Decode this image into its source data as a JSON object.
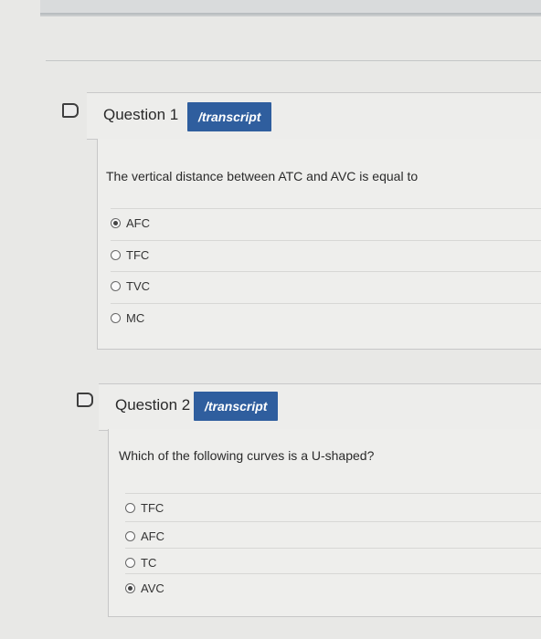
{
  "questions": [
    {
      "title": "Question 1",
      "transcript_label": "/transcript",
      "text": "The vertical distance between ATC and AVC is equal to",
      "options": [
        {
          "label": "AFC",
          "selected": true
        },
        {
          "label": "TFC",
          "selected": false
        },
        {
          "label": "TVC",
          "selected": false
        },
        {
          "label": "MC",
          "selected": false
        }
      ]
    },
    {
      "title": "Question 2",
      "transcript_label": "/transcript",
      "text": "Which of the following curves is a U-shaped?",
      "options": [
        {
          "label": "TFC",
          "selected": false
        },
        {
          "label": "AFC",
          "selected": false
        },
        {
          "label": "TC",
          "selected": false
        },
        {
          "label": "AVC",
          "selected": true
        }
      ]
    }
  ],
  "icons": {
    "flag": "flag-icon",
    "radio": "radio-button"
  }
}
